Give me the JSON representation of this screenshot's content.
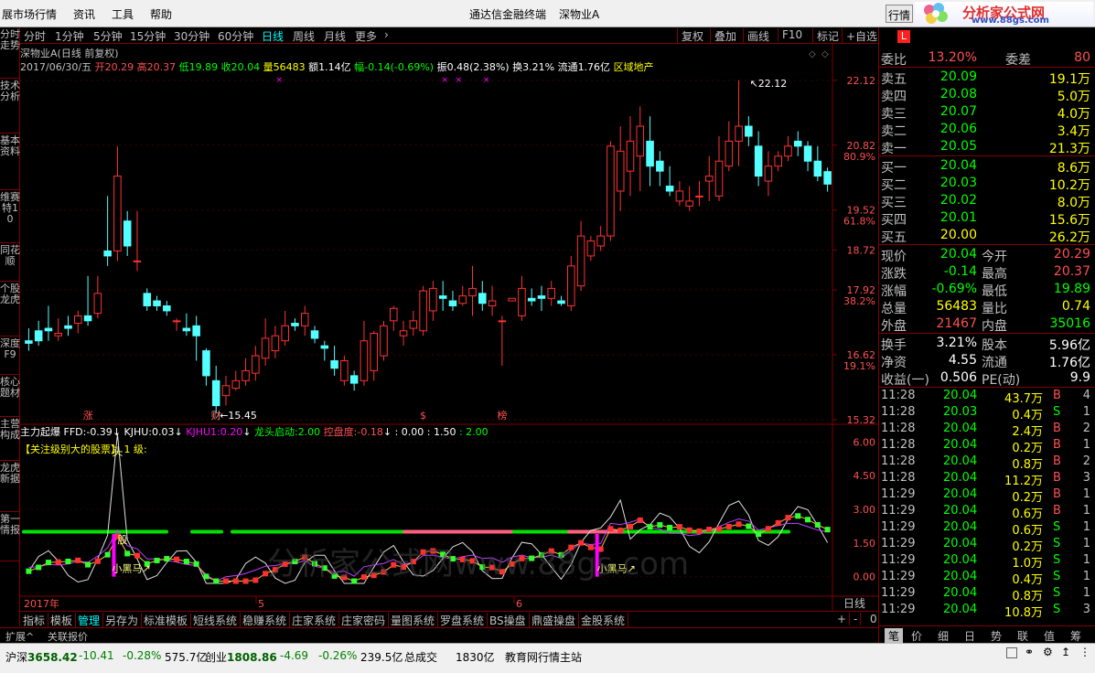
{
  "menu": {
    "items": [
      "展市场行情",
      "资讯",
      "工具",
      "帮助"
    ],
    "app_title": "通达信金融终端",
    "stock_title": "深物业A",
    "quote_button": "行情"
  },
  "logo": {
    "title": "分析家公式网",
    "site": "www.88gs.com"
  },
  "left_tabs": [
    "分时走势",
    "技术分析",
    "基本资料",
    "维赛特10",
    "同花顺",
    "个股龙虎",
    "深度F9",
    "核心题材",
    "主营构成",
    "龙虎新据",
    "第一情报"
  ],
  "toolbar": {
    "periods": [
      "分时",
      "1分钟",
      "5分钟",
      "15分钟",
      "30分钟",
      "60分钟",
      "日线",
      "周线",
      "月线",
      "更多"
    ],
    "selected": "日线",
    "buttons": [
      "复权",
      "叠加",
      "画线",
      "F10",
      "标记",
      "+自选"
    ]
  },
  "info": {
    "name_line": "深物业A(日线 前复权)",
    "date": "2017/06/30/五",
    "open_label": "开",
    "open": "20.29",
    "high_label": "高",
    "high": "20.37",
    "low_label": "低",
    "low": "19.89",
    "close_label": "收",
    "close": "20.04",
    "vol_label": "量",
    "vol": "56483",
    "amt_label": "额",
    "amt": "1.14亿",
    "chg_label": "幅",
    "chg": "-0.14(-0.69%)",
    "amp_label": "振",
    "amp": "0.48(2.38%)",
    "turn_label": "换",
    "turn": "3.21%",
    "float_label": "流通",
    "float": "1.76亿",
    "sector": "区域地产"
  },
  "chart_data": {
    "type": "candlestick",
    "ylim": [
      15.3,
      22.3
    ],
    "price_ticks": [
      "22.12",
      "20.82",
      "19.52",
      "18.72",
      "17.92",
      "16.62",
      "15.32"
    ],
    "pct_ticks": [
      "80.9%",
      "61.8%",
      "38.2%",
      "19.1%"
    ],
    "max_label": "22.12",
    "min_label": "15.45",
    "markers": [
      "涨",
      "财",
      "$",
      "榜"
    ],
    "candles": [
      [
        16.9,
        17.15,
        16.85,
        16.7
      ],
      [
        17.1,
        17.3,
        16.9,
        16.8
      ],
      [
        17.15,
        17.6,
        17.1,
        16.9
      ],
      [
        17.0,
        17.35,
        17.05,
        16.9
      ],
      [
        17.2,
        17.4,
        17.15,
        17.0
      ],
      [
        17.25,
        17.5,
        17.4,
        17.05
      ],
      [
        17.4,
        18.2,
        17.3,
        17.2
      ],
      [
        17.45,
        18.2,
        17.85,
        17.35
      ],
      [
        18.7,
        19.8,
        18.6,
        18.4
      ],
      [
        18.7,
        20.8,
        20.2,
        18.5
      ],
      [
        19.3,
        19.5,
        18.8,
        18.6
      ],
      [
        18.5,
        19.5,
        18.5,
        18.3
      ],
      [
        17.85,
        17.95,
        17.6,
        17.5
      ],
      [
        17.7,
        17.8,
        17.6,
        17.5
      ],
      [
        17.6,
        17.7,
        17.5,
        17.4
      ],
      [
        17.3,
        17.35,
        17.3,
        17.1
      ],
      [
        17.15,
        17.45,
        17.1,
        17.0
      ],
      [
        17.2,
        17.4,
        17.0,
        16.5
      ],
      [
        16.7,
        16.75,
        16.2,
        16.0
      ],
      [
        16.1,
        16.4,
        15.6,
        15.45
      ],
      [
        15.8,
        16.2,
        16.0,
        15.6
      ],
      [
        15.95,
        16.3,
        16.1,
        15.9
      ],
      [
        16.1,
        16.55,
        16.3,
        16.0
      ],
      [
        16.25,
        16.8,
        16.6,
        16.1
      ],
      [
        16.55,
        17.35,
        16.95,
        16.4
      ],
      [
        16.7,
        17.2,
        17.0,
        16.55
      ],
      [
        16.9,
        17.5,
        17.2,
        16.8
      ],
      [
        17.25,
        17.35,
        17.2,
        17.1
      ],
      [
        17.2,
        17.6,
        17.45,
        17.0
      ],
      [
        17.1,
        17.2,
        16.95,
        16.85
      ],
      [
        16.8,
        16.9,
        16.75,
        16.5
      ],
      [
        16.5,
        16.8,
        16.35,
        16.2
      ],
      [
        16.1,
        16.6,
        16.5,
        16.0
      ],
      [
        16.2,
        16.3,
        16.05,
        15.9
      ],
      [
        16.1,
        17.3,
        16.9,
        16.0
      ],
      [
        16.3,
        17.1,
        17.05,
        16.1
      ],
      [
        16.6,
        17.3,
        17.2,
        16.5
      ],
      [
        17.3,
        17.6,
        17.55,
        17.1
      ],
      [
        17.0,
        17.3,
        17.1,
        16.8
      ],
      [
        17.15,
        17.5,
        17.3,
        17.0
      ],
      [
        17.1,
        18.0,
        17.9,
        17.0
      ],
      [
        17.5,
        18.1,
        17.95,
        17.3
      ],
      [
        17.8,
        18.1,
        17.75,
        17.5
      ],
      [
        17.7,
        17.9,
        17.6,
        17.5
      ],
      [
        17.65,
        18.0,
        17.8,
        17.6
      ],
      [
        17.8,
        18.4,
        17.95,
        17.4
      ],
      [
        17.85,
        18.1,
        17.65,
        17.5
      ],
      [
        17.6,
        18.0,
        17.7,
        17.4
      ],
      [
        17.3,
        17.4,
        17.3,
        16.4
      ],
      [
        17.7,
        17.75,
        17.75,
        17.7
      ],
      [
        17.4,
        18.2,
        17.95,
        17.3
      ],
      [
        17.75,
        17.95,
        17.7,
        17.6
      ],
      [
        17.8,
        18.0,
        17.75,
        17.5
      ],
      [
        17.75,
        18.1,
        17.95,
        17.6
      ],
      [
        17.7,
        17.8,
        17.65,
        17.6
      ],
      [
        17.6,
        18.6,
        18.4,
        17.5
      ],
      [
        18.0,
        19.3,
        19.0,
        17.9
      ],
      [
        18.6,
        19.0,
        18.9,
        18.5
      ],
      [
        18.8,
        19.2,
        19.0,
        18.7
      ],
      [
        19.0,
        20.9,
        20.8,
        18.9
      ],
      [
        19.9,
        21.2,
        20.7,
        19.5
      ],
      [
        20.3,
        21.4,
        20.9,
        19.8
      ],
      [
        20.6,
        21.6,
        21.2,
        19.9
      ],
      [
        20.9,
        21.4,
        20.4,
        20.0
      ],
      [
        20.5,
        20.7,
        20.3,
        20.0
      ],
      [
        20.0,
        20.4,
        19.9,
        19.8
      ],
      [
        19.7,
        20.1,
        19.9,
        19.6
      ],
      [
        19.6,
        20.0,
        19.7,
        19.5
      ],
      [
        19.8,
        20.1,
        19.8,
        19.6
      ],
      [
        20.1,
        20.6,
        20.2,
        19.7
      ],
      [
        19.8,
        21.0,
        20.5,
        19.7
      ],
      [
        20.4,
        21.3,
        20.9,
        20.3
      ],
      [
        20.9,
        22.12,
        21.2,
        20.4
      ],
      [
        21.2,
        21.4,
        21.0,
        20.8
      ],
      [
        20.8,
        21.1,
        20.2,
        20.0
      ],
      [
        20.1,
        20.7,
        20.4,
        19.8
      ],
      [
        20.4,
        20.7,
        20.6,
        20.3
      ],
      [
        20.6,
        21.0,
        20.8,
        20.5
      ],
      [
        20.9,
        21.1,
        20.8,
        20.6
      ],
      [
        20.8,
        20.9,
        20.5,
        20.3
      ],
      [
        20.5,
        20.8,
        20.2,
        20.1
      ],
      [
        20.29,
        20.37,
        20.04,
        19.89
      ]
    ]
  },
  "indicator": {
    "name": "主力起爆",
    "ffd_label": "FFD:",
    "ffd": "-0.39",
    "kjhu_label": "KJHU:",
    "kjhu": "0.03",
    "kjhu1_label": "KJHU1:",
    "kjhu1": "0.20",
    "ltqd_label": "龙头启动:",
    "ltqd": "2.00",
    "kpd_label": "控盘度:",
    "kpd": "-0.18",
    "extra": ": 0.00 : 1.50",
    "extra2": ": 2.00",
    "note": "【关注级别大的股票】  1 级:",
    "ticks": [
      "6.00",
      "4.50",
      "3.00",
      "1.50",
      "0.00"
    ],
    "labels": {
      "head": "头",
      "stock": "股",
      "darkhorse": "小黑马",
      "darkhorse2": "小黑马"
    },
    "watermark": "分析家公式网www.88gs.com"
  },
  "time_axis": {
    "year": "2017年",
    "m5": "5",
    "m6": "6",
    "period": "日线"
  },
  "tabs": {
    "items": [
      "指标",
      "模板",
      "管理",
      "另存为",
      "标准模板",
      "短线系统",
      "稳赚系统",
      "庄家系统",
      "庄家密码",
      "量图系统",
      "罗盘系统",
      "BS操盘",
      "鼎盛操盘",
      "金股系统"
    ],
    "selected": "管理"
  },
  "expand": {
    "left": "扩展^",
    "right": "关联报价"
  },
  "status": {
    "sh_label": "沪深",
    "sh_val": "3658.42",
    "sh_chg": "-10.41",
    "sh_pct": "-0.28%",
    "sh_amt": "575.7亿",
    "cy_label": "创业",
    "cy_val": "1808.86",
    "cy_chg": "-4.69",
    "cy_pct": "-0.26%",
    "cy_amt": "239.5亿",
    "total_label": "总成交",
    "total": "1830亿",
    "station": "教育网行情主站"
  },
  "right": {
    "badge": "L",
    "webi_label": "委比",
    "webi": "13.20%",
    "wecha_label": "委差",
    "wecha": "80",
    "asks": [
      {
        "label": "卖五",
        "price": "20.09",
        "vol": "19.1万"
      },
      {
        "label": "卖四",
        "price": "20.08",
        "vol": "5.0万"
      },
      {
        "label": "卖三",
        "price": "20.07",
        "vol": "4.0万"
      },
      {
        "label": "卖二",
        "price": "20.06",
        "vol": "3.4万"
      },
      {
        "label": "卖一",
        "price": "20.05",
        "vol": "21.3万"
      }
    ],
    "bids": [
      {
        "label": "买一",
        "price": "20.04",
        "vol": "8.6万"
      },
      {
        "label": "买二",
        "price": "20.03",
        "vol": "10.2万"
      },
      {
        "label": "买三",
        "price": "20.02",
        "vol": "8.0万"
      },
      {
        "label": "买四",
        "price": "20.01",
        "vol": "15.6万"
      },
      {
        "label": "买五",
        "price": "20.00",
        "vol": "26.2万"
      }
    ],
    "stats1": [
      {
        "l1": "现价",
        "v1": "20.04",
        "l2": "今开",
        "v2": "20.29"
      },
      {
        "l1": "涨跌",
        "v1": "-0.14",
        "l2": "最高",
        "v2": "20.37"
      },
      {
        "l1": "涨幅",
        "v1": "-0.69%",
        "l2": "最低",
        "v2": "19.89"
      },
      {
        "l1": "总量",
        "v1": "56483",
        "l2": "量比",
        "v2": "0.74"
      },
      {
        "l1": "外盘",
        "v1": "21467",
        "l2": "内盘",
        "v2": "35016"
      }
    ],
    "stats2": [
      {
        "l1": "换手",
        "v1": "3.21%",
        "l2": "股本",
        "v2": "5.96亿"
      },
      {
        "l1": "净资",
        "v1": "4.55",
        "l2": "流通",
        "v2": "1.76亿"
      },
      {
        "l1": "收益(一)",
        "v1": "0.506",
        "l2": "PE(动)",
        "v2": "9.9"
      }
    ],
    "ticks": [
      {
        "t": "11:28",
        "p": "20.04",
        "v": "43.7万",
        "s": "B",
        "n": "4"
      },
      {
        "t": "11:28",
        "p": "20.03",
        "v": "0.4万",
        "s": "S",
        "n": "1"
      },
      {
        "t": "11:28",
        "p": "20.04",
        "v": "2.4万",
        "s": "B",
        "n": "2"
      },
      {
        "t": "11:28",
        "p": "20.04",
        "v": "0.2万",
        "s": "B",
        "n": "1"
      },
      {
        "t": "11:28",
        "p": "20.04",
        "v": "0.8万",
        "s": "B",
        "n": "2"
      },
      {
        "t": "11:28",
        "p": "20.04",
        "v": "11.2万",
        "s": "B",
        "n": "3"
      },
      {
        "t": "11:29",
        "p": "20.04",
        "v": "0.2万",
        "s": "B",
        "n": "1"
      },
      {
        "t": "11:29",
        "p": "20.04",
        "v": "0.6万",
        "s": "B",
        "n": "1"
      },
      {
        "t": "11:29",
        "p": "20.04",
        "v": "0.6万",
        "s": "S",
        "n": "1"
      },
      {
        "t": "11:29",
        "p": "20.04",
        "v": "0.2万",
        "s": "S",
        "n": "1"
      },
      {
        "t": "11:29",
        "p": "20.04",
        "v": "1.0万",
        "s": "S",
        "n": "1"
      },
      {
        "t": "11:29",
        "p": "20.04",
        "v": "0.4万",
        "s": "S",
        "n": "1"
      },
      {
        "t": "11:29",
        "p": "20.04",
        "v": "0.8万",
        "s": "S",
        "n": "1"
      },
      {
        "t": "11:29",
        "p": "20.04",
        "v": "10.8万",
        "s": "S",
        "n": "3"
      }
    ],
    "bottom_tabs": [
      "笔",
      "价",
      "细",
      "日",
      "势",
      "联",
      "值",
      "筹"
    ],
    "bottom_selected": "笔"
  },
  "colors": {
    "up": "#ff3232",
    "down": "#54ffff",
    "frame": "#800000",
    "bg": "#000000"
  }
}
